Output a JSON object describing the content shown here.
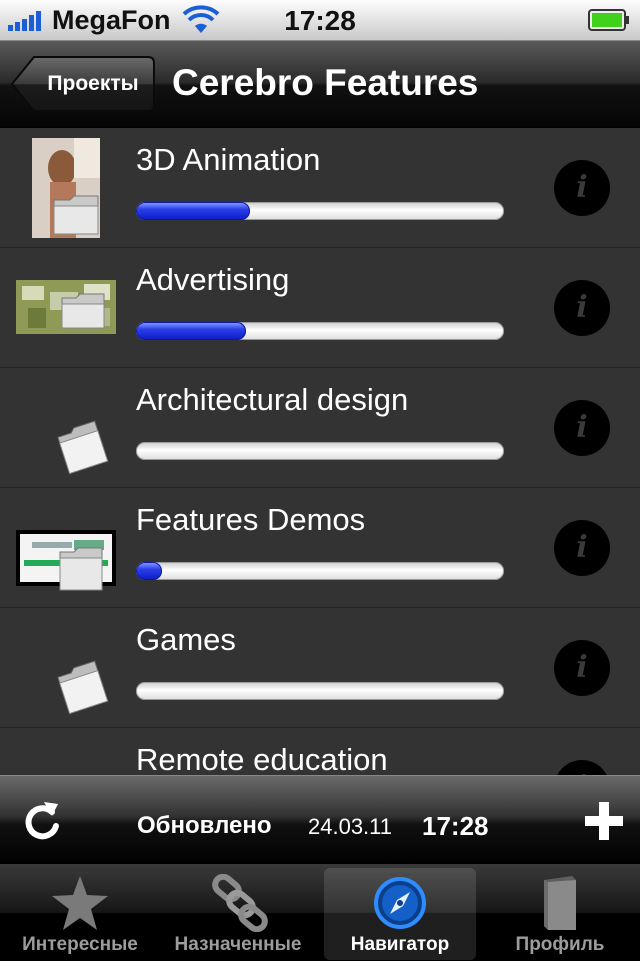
{
  "status_bar": {
    "carrier": "MegaFon",
    "time": "17:28"
  },
  "nav": {
    "back_label": "Проекты",
    "title": "Cerebro Features"
  },
  "projects": [
    {
      "name": "3D Animation",
      "progress": 0.31,
      "thumb_icon": "photo-folder-icon"
    },
    {
      "name": "Advertising",
      "progress": 0.3,
      "thumb_icon": "photo-folder-icon"
    },
    {
      "name": "Architectural design",
      "progress": 0.0,
      "thumb_icon": "folder-icon"
    },
    {
      "name": "Features Demos",
      "progress": 0.07,
      "thumb_icon": "photo-folder-icon"
    },
    {
      "name": "Games",
      "progress": 0.0,
      "thumb_icon": "folder-icon"
    },
    {
      "name": "Remote education",
      "progress": 0.0,
      "thumb_icon": "folder-icon"
    }
  ],
  "toolbar": {
    "updated_label": "Обновлено",
    "updated_date": "24.03.11",
    "updated_time": "17:28"
  },
  "tabs": [
    {
      "label": "Интересные",
      "icon": "star-icon"
    },
    {
      "label": "Назначенные",
      "icon": "chain-link-icon"
    },
    {
      "label": "Навигатор",
      "icon": "compass-icon",
      "active": true
    },
    {
      "label": "Профиль",
      "icon": "book-icon"
    }
  ],
  "colors": {
    "progress_fill": "#1a2fe0",
    "compass_accent": "#2f8cff",
    "battery": "#3fd11b"
  }
}
